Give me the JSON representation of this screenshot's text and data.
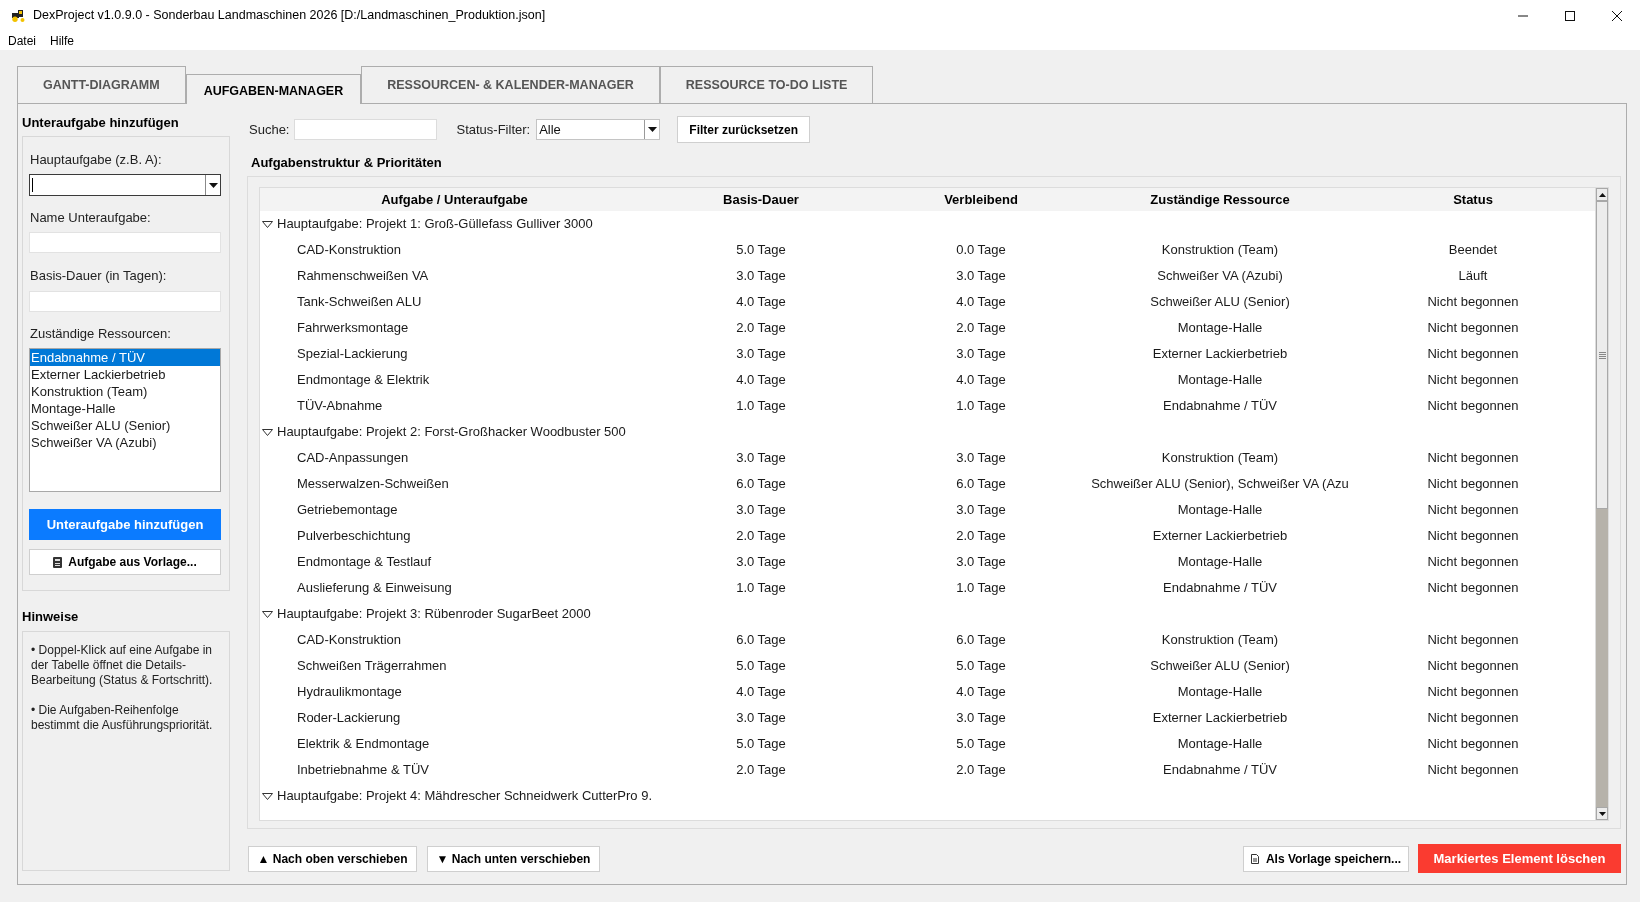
{
  "window": {
    "title": "DexProject v1.0.9.0 - Sonderbau Landmaschinen 2026 [D:/Landmaschinen_Produktion.json]"
  },
  "menu": [
    "Datei",
    "Hilfe"
  ],
  "tabs": [
    {
      "label": "GANTT-DIAGRAMM",
      "selected": false
    },
    {
      "label": "AUFGABEN-MANAGER",
      "selected": true
    },
    {
      "label": "RESSOURCEN- & KALENDER-MANAGER",
      "selected": false
    },
    {
      "label": "RESSOURCE TO-DO LISTE",
      "selected": false
    }
  ],
  "add_subtask": {
    "title": "Unteraufgabe hinzufügen",
    "main_task": {
      "label": "Hauptaufgabe (z.B. A):",
      "focused": true
    },
    "name": {
      "label": "Name Unteraufgabe:"
    },
    "duration": {
      "label": "Basis-Dauer (in Tagen):"
    },
    "resources": {
      "label": "Zuständige Ressourcen:",
      "items": [
        {
          "label": "Endabnahme / TÜV",
          "selected": true
        },
        {
          "label": "Externer Lackierbetrieb",
          "selected": false
        },
        {
          "label": "Konstruktion (Team)",
          "selected": false
        },
        {
          "label": "Montage-Halle",
          "selected": false
        },
        {
          "label": "Schweißer ALU (Senior)",
          "selected": false
        },
        {
          "label": "Schweißer VA (Azubi)",
          "selected": false
        }
      ]
    },
    "add_button": "Unteraufgabe hinzufügen",
    "template_button": "Aufgabe aus Vorlage..."
  },
  "notes": {
    "title": "Hinweise",
    "paragraphs": [
      "• Doppel-Klick auf eine Aufgabe in der Tabelle öffnet die Details-Bearbeitung (Status & Fortschritt).",
      "• Die Aufgaben-Reihenfolge bestimmt die Ausführungspriorität."
    ]
  },
  "filter": {
    "search_label": "Suche:",
    "status_label": "Status-Filter:",
    "status_value": "Alle",
    "reset_button": "Filter zurücksetzen"
  },
  "task_tree": {
    "title": "Aufgabenstruktur & Prioritäten",
    "columns": [
      "Aufgabe / Unteraufgabe",
      "Basis-Dauer",
      "Verbleibend",
      "Zuständige Ressource",
      "Status"
    ],
    "groups": [
      {
        "label": "Hauptaufgabe: Projekt 1: Groß-Güllefass Gulliver 3000",
        "expanded": true,
        "children": [
          {
            "task": "CAD-Konstruktion",
            "base_duration": "5.0 Tage",
            "remaining": "0.0 Tage",
            "resource": "Konstruktion (Team)",
            "status": "Beendet"
          },
          {
            "task": "Rahmenschweißen VA",
            "base_duration": "3.0 Tage",
            "remaining": "3.0 Tage",
            "resource": "Schweißer VA (Azubi)",
            "status": "Läuft"
          },
          {
            "task": "Tank-Schweißen ALU",
            "base_duration": "4.0 Tage",
            "remaining": "4.0 Tage",
            "resource": "Schweißer ALU (Senior)",
            "status": "Nicht begonnen"
          },
          {
            "task": "Fahrwerksmontage",
            "base_duration": "2.0 Tage",
            "remaining": "2.0 Tage",
            "resource": "Montage-Halle",
            "status": "Nicht begonnen"
          },
          {
            "task": "Spezial-Lackierung",
            "base_duration": "3.0 Tage",
            "remaining": "3.0 Tage",
            "resource": "Externer Lackierbetrieb",
            "status": "Nicht begonnen"
          },
          {
            "task": "Endmontage & Elektrik",
            "base_duration": "4.0 Tage",
            "remaining": "4.0 Tage",
            "resource": "Montage-Halle",
            "status": "Nicht begonnen"
          },
          {
            "task": "TÜV-Abnahme",
            "base_duration": "1.0 Tage",
            "remaining": "1.0 Tage",
            "resource": "Endabnahme / TÜV",
            "status": "Nicht begonnen"
          }
        ]
      },
      {
        "label": "Hauptaufgabe: Projekt 2: Forst-Großhacker Woodbuster 500",
        "expanded": true,
        "children": [
          {
            "task": "CAD-Anpassungen",
            "base_duration": "3.0 Tage",
            "remaining": "3.0 Tage",
            "resource": "Konstruktion (Team)",
            "status": "Nicht begonnen"
          },
          {
            "task": "Messerwalzen-Schweißen",
            "base_duration": "6.0 Tage",
            "remaining": "6.0 Tage",
            "resource": "Schweißer ALU (Senior), Schweißer VA (Azu",
            "status": "Nicht begonnen"
          },
          {
            "task": "Getriebemontage",
            "base_duration": "3.0 Tage",
            "remaining": "3.0 Tage",
            "resource": "Montage-Halle",
            "status": "Nicht begonnen"
          },
          {
            "task": "Pulverbeschichtung",
            "base_duration": "2.0 Tage",
            "remaining": "2.0 Tage",
            "resource": "Externer Lackierbetrieb",
            "status": "Nicht begonnen"
          },
          {
            "task": "Endmontage & Testlauf",
            "base_duration": "3.0 Tage",
            "remaining": "3.0 Tage",
            "resource": "Montage-Halle",
            "status": "Nicht begonnen"
          },
          {
            "task": "Auslieferung & Einweisung",
            "base_duration": "1.0 Tage",
            "remaining": "1.0 Tage",
            "resource": "Endabnahme / TÜV",
            "status": "Nicht begonnen"
          }
        ]
      },
      {
        "label": "Hauptaufgabe: Projekt 3: Rübenroder SugarBeet 2000",
        "expanded": true,
        "children": [
          {
            "task": "CAD-Konstruktion",
            "base_duration": "6.0 Tage",
            "remaining": "6.0 Tage",
            "resource": "Konstruktion (Team)",
            "status": "Nicht begonnen"
          },
          {
            "task": "Schweißen Trägerrahmen",
            "base_duration": "5.0 Tage",
            "remaining": "5.0 Tage",
            "resource": "Schweißer ALU (Senior)",
            "status": "Nicht begonnen"
          },
          {
            "task": "Hydraulikmontage",
            "base_duration": "4.0 Tage",
            "remaining": "4.0 Tage",
            "resource": "Montage-Halle",
            "status": "Nicht begonnen"
          },
          {
            "task": "Roder-Lackierung",
            "base_duration": "3.0 Tage",
            "remaining": "3.0 Tage",
            "resource": "Externer Lackierbetrieb",
            "status": "Nicht begonnen"
          },
          {
            "task": "Elektrik & Endmontage",
            "base_duration": "5.0 Tage",
            "remaining": "5.0 Tage",
            "resource": "Montage-Halle",
            "status": "Nicht begonnen"
          },
          {
            "task": "Inbetriebnahme & TÜV",
            "base_duration": "2.0 Tage",
            "remaining": "2.0 Tage",
            "resource": "Endabnahme / TÜV",
            "status": "Nicht begonnen"
          }
        ]
      },
      {
        "label": "Hauptaufgabe: Projekt 4: Mähdrescher Schneidwerk CutterPro 9.",
        "expanded": true
      }
    ]
  },
  "actions": {
    "move_up": "▲ Nach oben verschieben",
    "move_down": "▼ Nach unten verschieben",
    "save_template": "Als Vorlage speichern...",
    "delete": "Markiertes Element löschen"
  }
}
